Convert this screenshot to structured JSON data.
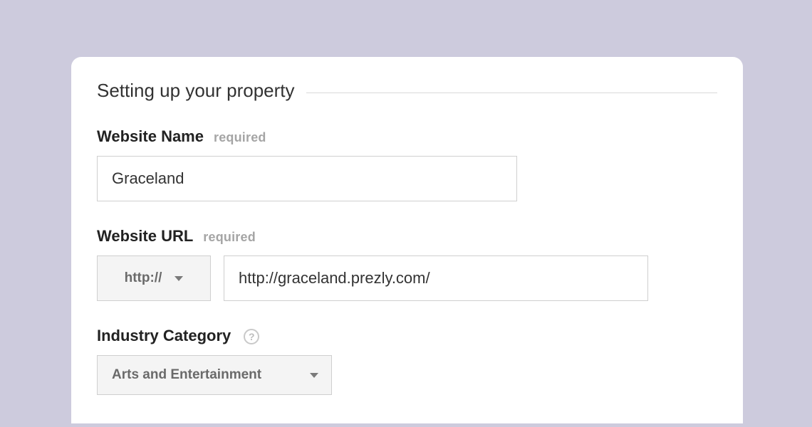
{
  "section_title": "Setting up your property",
  "required_label": "required",
  "fields": {
    "website_name": {
      "label": "Website Name",
      "value": "Graceland"
    },
    "website_url": {
      "label": "Website URL",
      "protocol": "http://",
      "value": "http://graceland.prezly.com/"
    },
    "industry_category": {
      "label": "Industry Category",
      "value": "Arts and Entertainment"
    }
  },
  "help_glyph": "?"
}
